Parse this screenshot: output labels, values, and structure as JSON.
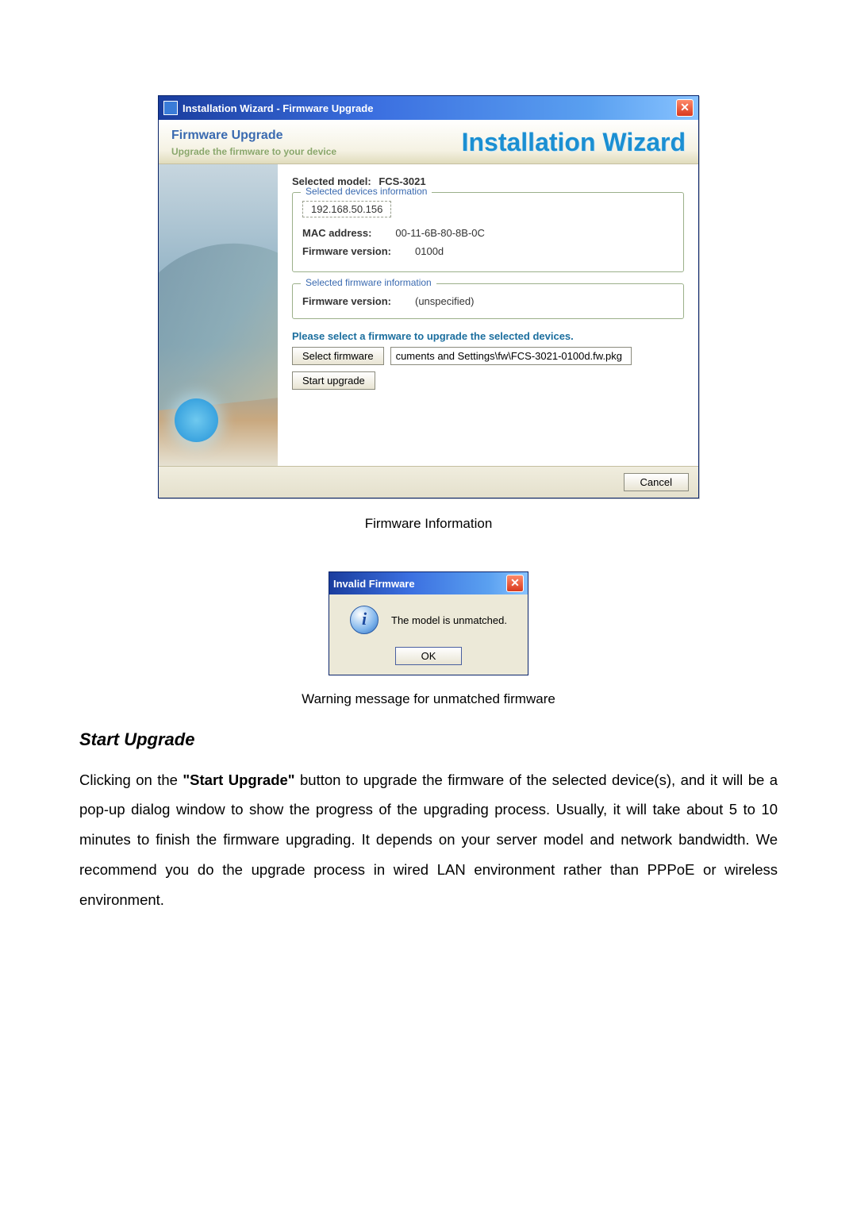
{
  "win": {
    "title": "Installation Wizard - Firmware Upgrade",
    "header_title": "Firmware Upgrade",
    "header_sub": "Upgrade the firmware to your device",
    "brand": "Installation Wizard",
    "selected_model_label": "Selected model:",
    "selected_model_value": "FCS-3021",
    "group1_title": "Selected devices information",
    "ip": "192.168.50.156",
    "mac_label": "MAC address:",
    "mac_value": "00-11-6B-80-8B-0C",
    "fw_label": "Firmware version:",
    "fw_value": "0100d",
    "group2_title": "Selected firmware information",
    "fw2_label": "Firmware version:",
    "fw2_value": "(unspecified)",
    "instr": "Please select a firmware to upgrade the selected devices.",
    "select_btn": "Select firmware",
    "fw_path": "cuments and Settings\\fw\\FCS-3021-0100d.fw.pkg",
    "start_btn": "Start upgrade",
    "cancel": "Cancel",
    "close_glyph": "✕"
  },
  "caption1": "Firmware Information",
  "dlg": {
    "title": "Invalid Firmware",
    "msg": "The model is unmatched.",
    "ok": "OK",
    "info_glyph": "i",
    "close_glyph": "✕"
  },
  "caption2": "Warning message for unmatched firmware",
  "doc": {
    "heading": "Start Upgrade",
    "p1a": "Clicking on the ",
    "p1b": "\"Start Upgrade\"",
    "p1c": " button to upgrade the firmware of the selected device(s), and it will be a pop-up dialog window to show the progress of the upgrading process. Usually, it will take about 5 to 10 minutes to finish the firmware upgrading. It depends on your server model and network bandwidth. We recommend you do the upgrade process in wired LAN environment rather than PPPoE or wireless environment."
  }
}
